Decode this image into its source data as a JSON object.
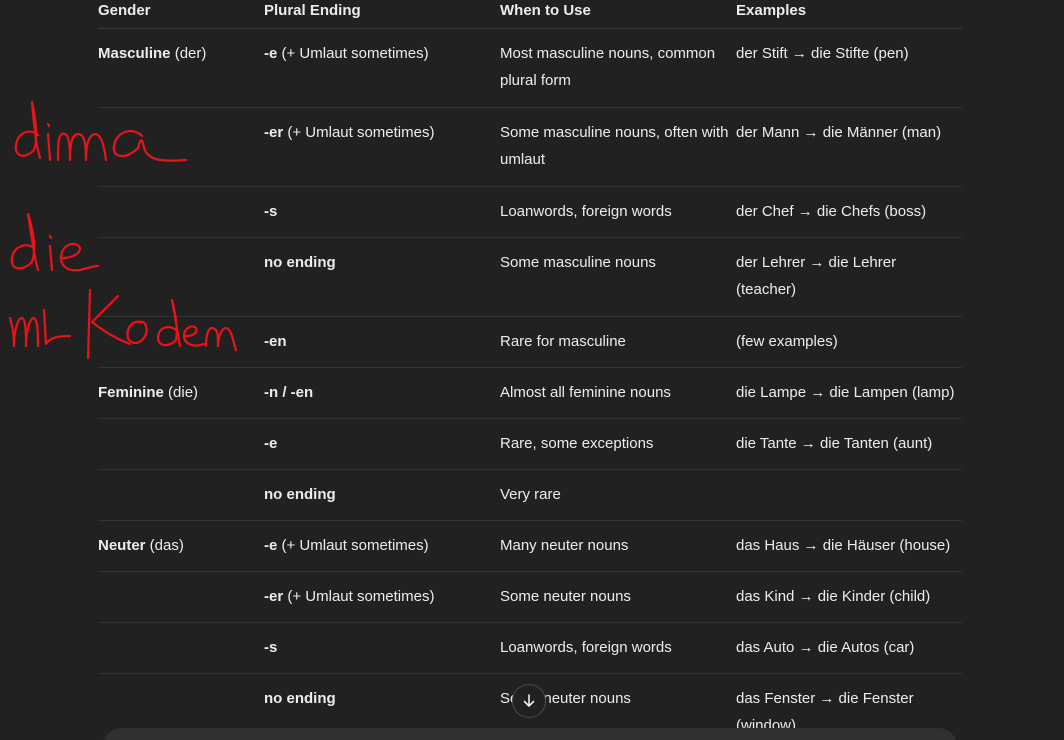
{
  "table": {
    "headers": [
      "Gender",
      "Plural Ending",
      "When to Use",
      "Examples"
    ],
    "rows": [
      {
        "gender_bold": "Masculine",
        "gender_rest": " (der)",
        "ending_bold": "-e",
        "ending_rest": " (+ Umlaut sometimes)",
        "use": "Most masculine nouns, common plural form",
        "example": "der Stift → die Stifte (pen)"
      },
      {
        "gender_bold": "",
        "gender_rest": "",
        "ending_bold": "-er",
        "ending_rest": " (+ Umlaut sometimes)",
        "use": "Some masculine nouns, often with umlaut",
        "example": "der Mann → die Männer (man)"
      },
      {
        "gender_bold": "",
        "gender_rest": "",
        "ending_bold": "-s",
        "ending_rest": "",
        "use": "Loanwords, foreign words",
        "example": "der Chef → die Chefs (boss)"
      },
      {
        "gender_bold": "",
        "gender_rest": "",
        "ending_bold": "no ending",
        "ending_rest": "",
        "use": "Some masculine nouns",
        "example": "der Lehrer → die Lehrer (teacher)"
      },
      {
        "gender_bold": "",
        "gender_rest": "",
        "ending_bold": "-en",
        "ending_rest": "",
        "use": "Rare for masculine",
        "example": "(few examples)"
      },
      {
        "gender_bold": "Feminine",
        "gender_rest": " (die)",
        "ending_bold": "-n / -en",
        "ending_rest": "",
        "use": "Almost all feminine nouns",
        "example": "die Lampe → die Lampen (lamp)"
      },
      {
        "gender_bold": "",
        "gender_rest": "",
        "ending_bold": "-e",
        "ending_rest": "",
        "use": "Rare, some exceptions",
        "example": "die Tante → die Tanten (aunt)"
      },
      {
        "gender_bold": "",
        "gender_rest": "",
        "ending_bold": "no ending",
        "ending_rest": "",
        "use": "Very rare",
        "example": ""
      },
      {
        "gender_bold": "Neuter",
        "gender_rest": " (das)",
        "ending_bold": "-e",
        "ending_rest": " (+ Umlaut sometimes)",
        "use": "Many neuter nouns",
        "example": "das Haus → die Häuser (house)"
      },
      {
        "gender_bold": "",
        "gender_rest": "",
        "ending_bold": "-er",
        "ending_rest": " (+ Umlaut sometimes)",
        "use": "Some neuter nouns",
        "example": "das Kind → die Kinder (child)"
      },
      {
        "gender_bold": "",
        "gender_rest": "",
        "ending_bold": "-s",
        "ending_rest": "",
        "use": "Loanwords, foreign words",
        "example": "das Auto → die Autos (car)"
      },
      {
        "gender_bold": "",
        "gender_rest": "",
        "ending_bold": "no ending",
        "ending_rest": "",
        "use": "Some neuter nouns",
        "example": "das Fenster → die Fenster (window)"
      }
    ]
  },
  "annotation": {
    "color": "#e8141a",
    "lines": [
      "dima",
      "die",
      "mit Kodem"
    ]
  },
  "scroll_button": {
    "icon": "arrow-down-icon"
  },
  "colors": {
    "background": "#212121",
    "text": "#ececec"
  }
}
